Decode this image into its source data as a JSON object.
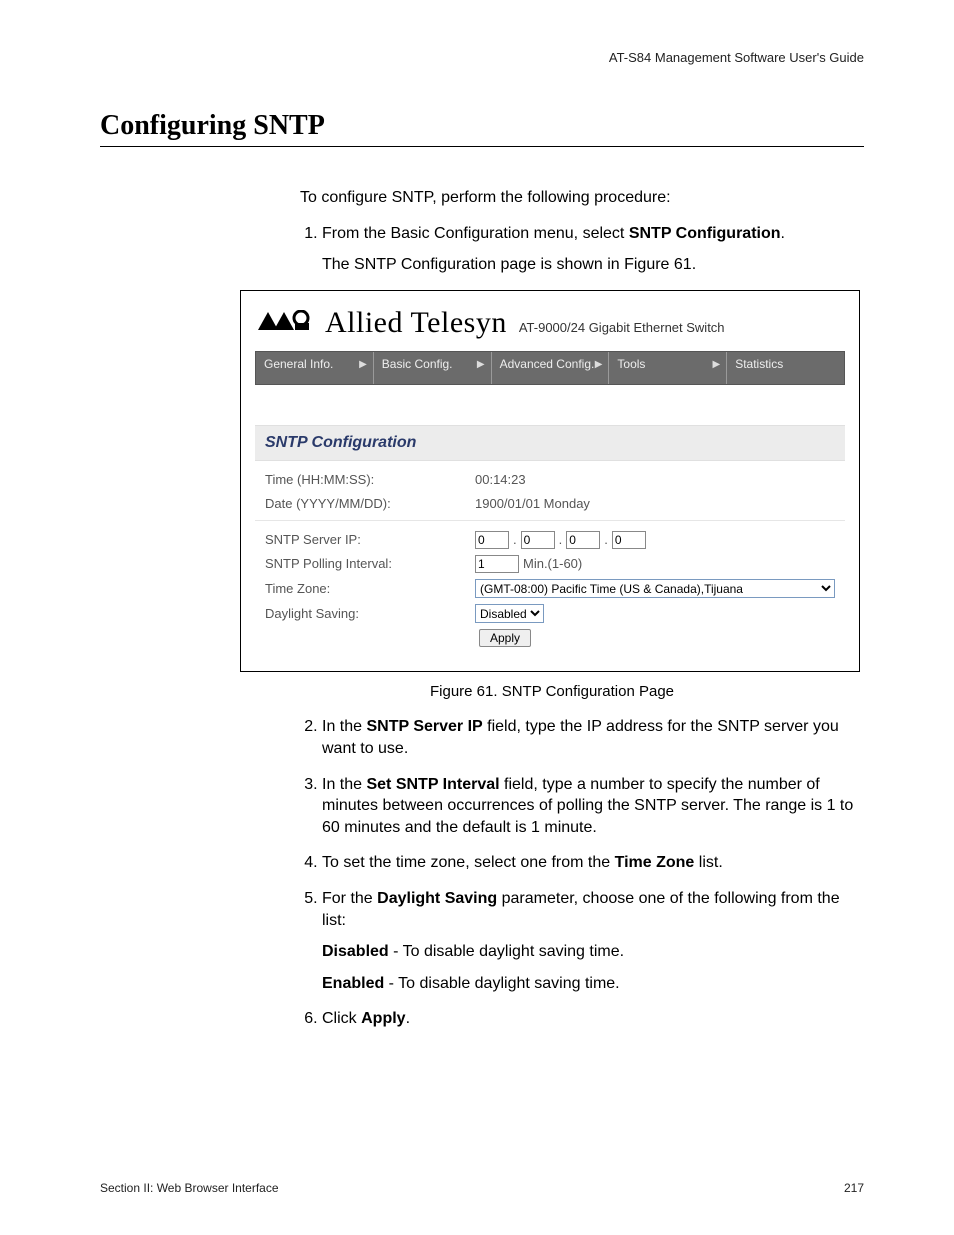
{
  "running_head": "AT-S84 Management Software User's Guide",
  "section_title": "Configuring SNTP",
  "intro": "To configure SNTP, perform the following procedure:",
  "steps": {
    "s1_a": "From the Basic Configuration menu, select ",
    "s1_b": "SNTP Configuration",
    "s1_c": ".",
    "s1_follow": "The SNTP Configuration page is shown in Figure 61.",
    "s2_a": "In the ",
    "s2_b": "SNTP Server IP",
    "s2_c": " field, type the IP address for the SNTP server you want to use.",
    "s3_a": "In the ",
    "s3_b": "Set SNTP Interval",
    "s3_c": " field, type a number to specify the number of minutes between occurrences of polling the SNTP server. The range is 1 to 60 minutes and the default is 1 minute.",
    "s4_a": "To set the time zone, select one from the ",
    "s4_b": "Time Zone",
    "s4_c": " list.",
    "s5_a": "For the ",
    "s5_b": "Daylight Saving",
    "s5_c": " parameter, choose one of the following from the list:",
    "s5_opt1_b": "Disabled",
    "s5_opt1_t": " - To disable daylight saving time.",
    "s5_opt2_b": "Enabled",
    "s5_opt2_t": " - To disable daylight saving time.",
    "s6_a": "Click ",
    "s6_b": "Apply",
    "s6_c": "."
  },
  "figure": {
    "brand": "Allied Telesyn",
    "brand_sub": "AT-9000/24 Gigabit Ethernet Switch",
    "menu": [
      "General Info.",
      "Basic Config.",
      "Advanced Config.",
      "Tools",
      "Statistics"
    ],
    "panel_title": "SNTP Configuration",
    "rows": {
      "time_label": "Time (HH:MM:SS):",
      "time_value": "00:14:23",
      "date_label": "Date (YYYY/MM/DD):",
      "date_value": "1900/01/01 Monday",
      "ip_label": "SNTP Server IP:",
      "ip": [
        "0",
        "0",
        "0",
        "0"
      ],
      "dot": ".",
      "poll_label": "SNTP Polling Interval:",
      "poll_value": "1",
      "poll_unit": "Min.(1-60)",
      "tz_label": "Time Zone:",
      "tz_value": "(GMT-08:00) Pacific Time (US & Canada),Tijuana",
      "ds_label": "Daylight Saving:",
      "ds_value": "Disabled",
      "apply": "Apply"
    },
    "caption": "Figure 61. SNTP Configuration Page"
  },
  "footer": {
    "left": "Section II: Web Browser Interface",
    "right": "217"
  }
}
